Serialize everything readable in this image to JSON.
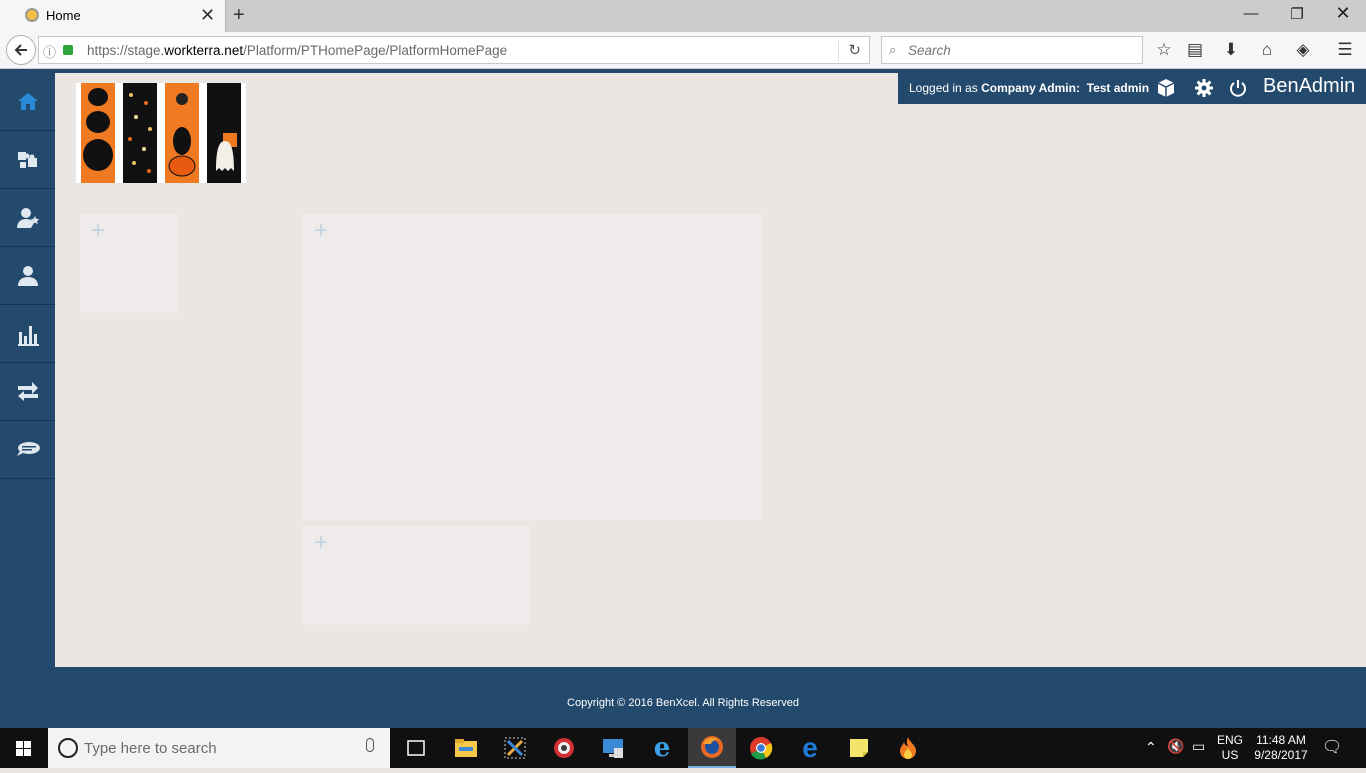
{
  "browser": {
    "tab_title": "Home",
    "url_prefix": "https://stage.",
    "url_domain": "workterra.net",
    "url_path": "/Platform/PTHomePage/PlatformHomePage",
    "search_placeholder": "Search"
  },
  "app": {
    "brand": "BenAdmin",
    "login_prefix": "Logged in as",
    "login_role": "Company Admin:",
    "login_user": "Test admin",
    "footer_copyright": "Copyright © 2016 BenXcel. All Rights Reserved",
    "colors": {
      "primary": "#23496d",
      "background": "#eae6e4",
      "widget": "#efebea",
      "widget_plus": "#c3d3e3"
    },
    "sidebar_icons": [
      "home-icon",
      "puzzle-icon",
      "user-star-icon",
      "user-icon",
      "bar-chart-icon",
      "transfer-arrows-icon",
      "chat-bubble-icon"
    ],
    "widgets": [
      {
        "label": "+"
      },
      {
        "label": "+"
      },
      {
        "label": "+"
      }
    ]
  },
  "taskbar": {
    "search_placeholder": "Type here to search",
    "lang_top": "ENG",
    "lang_bottom": "US",
    "time": "11:48 AM",
    "date": "9/28/2017"
  }
}
